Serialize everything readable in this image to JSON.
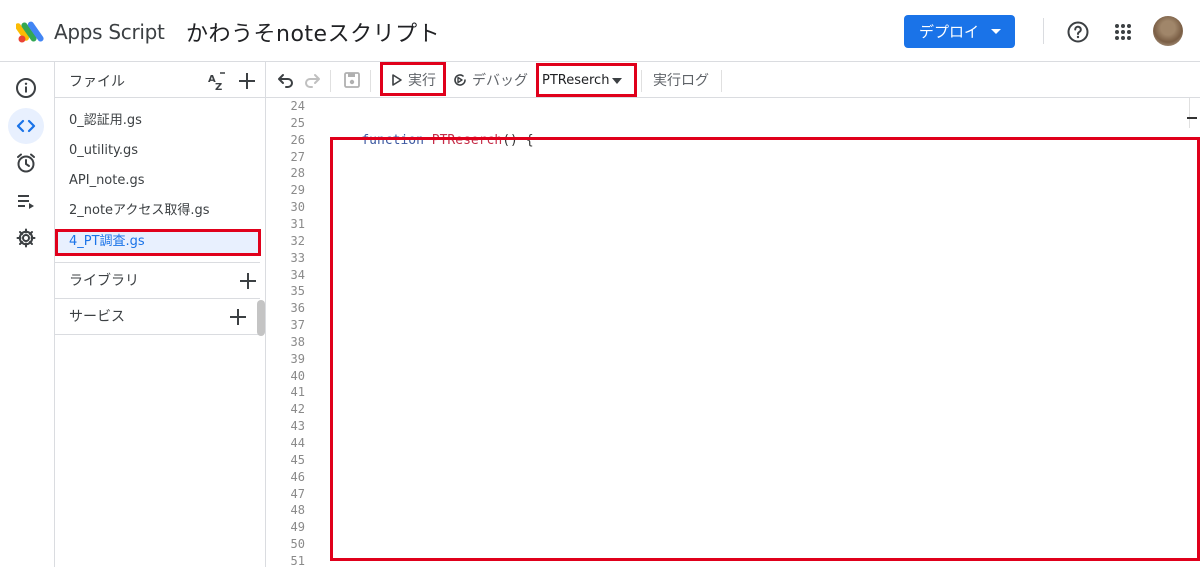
{
  "header": {
    "app_name": "Apps Script",
    "project_name": "かわうそnoteスクリプト",
    "deploy_label": "デプロイ",
    "brand_color": "#1a73e8"
  },
  "rail": {
    "items": [
      {
        "icon": "info-icon",
        "label": "Overview"
      },
      {
        "icon": "code-icon",
        "label": "Editor",
        "active": true
      },
      {
        "icon": "alarm-clock-icon",
        "label": "Triggers"
      },
      {
        "icon": "playlist-icon",
        "label": "Executions"
      },
      {
        "icon": "gear-icon",
        "label": "Project settings"
      }
    ]
  },
  "files": {
    "title": "ファイル",
    "sort_icon": "az-sort-icon",
    "items": [
      {
        "label": "0_認証用.gs"
      },
      {
        "label": "0_utility.gs"
      },
      {
        "label": "API_note.gs"
      },
      {
        "label": "2_noteアクセス取得.gs"
      },
      {
        "label": "4_PT調査.gs",
        "active": true
      }
    ],
    "sections": [
      {
        "label": "ライブラリ"
      },
      {
        "label": "サービス"
      }
    ]
  },
  "toolbar": {
    "run_label": "実行",
    "debug_label": "デバッグ",
    "function_name": "PTReserch",
    "log_label": "実行ログ"
  },
  "editor": {
    "line_numbers": [
      "24",
      "25",
      "26",
      "27",
      "28",
      "29",
      "30",
      "31",
      "32",
      "33",
      "34",
      "35",
      "36",
      "37",
      "38",
      "39",
      "40",
      "41",
      "42",
      "43",
      "44",
      "45",
      "46",
      "47",
      "48",
      "49",
      "50",
      "51"
    ],
    "code": {
      "keyword": "function",
      "function_name": "PTReserch",
      "rest": "() {"
    }
  },
  "highlight_color": "#e0001b"
}
